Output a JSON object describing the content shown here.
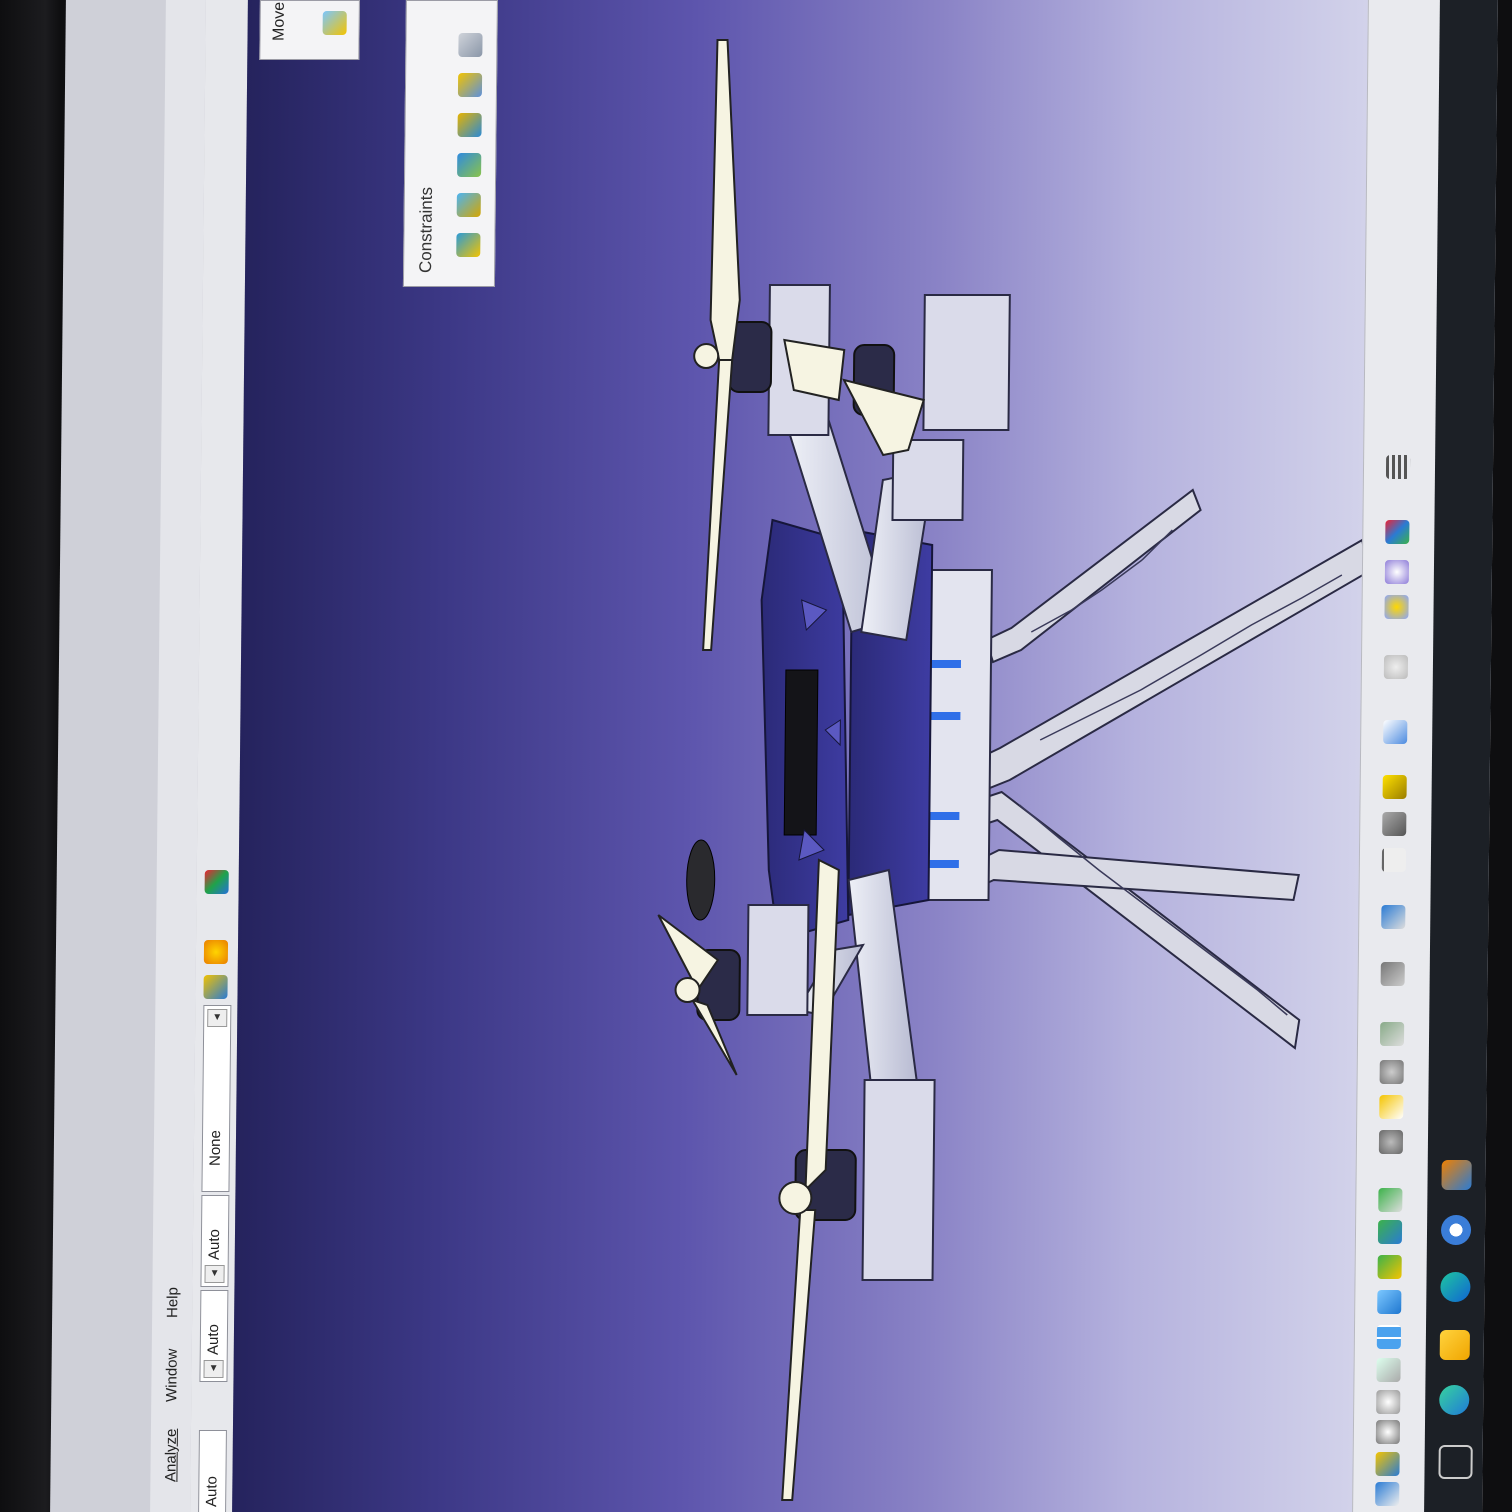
{
  "menu": {
    "items": [
      "Analyze",
      "Window",
      "Help"
    ]
  },
  "toolbar": {
    "combo_values": [
      "Auto",
      "Auto",
      "Auto",
      "None"
    ]
  },
  "panels": {
    "constraints_title": "Constraints",
    "move_title": "Move"
  },
  "viewport": {
    "background_gradient": [
      "#25235d",
      "#5d55ad",
      "#d2d2ea"
    ],
    "model": "quadcopter-assembly"
  },
  "icons": {
    "left_toolbar": [
      "paint-icon",
      "color-icon",
      "material-icon"
    ],
    "right_toolbar": [
      "grid-icon",
      "multi-color-icon",
      "sphere-icon",
      "star-icon",
      "refresh-icon",
      "cube-icon",
      "cylinder-icon",
      "stamp-icon",
      "measure-icon",
      "measure-item-icon",
      "camera-icon",
      "explode-icon",
      "gear-icon",
      "clash-icon",
      "gears-icon",
      "snap-icon",
      "view-icon",
      "normal-view-icon",
      "isometric-icon",
      "multi-view-icon",
      "plane-icon",
      "zoom-icon",
      "zoom-in-icon",
      "rotate-icon",
      "pan-icon"
    ],
    "taskbar": [
      "app-icon",
      "chrome-icon",
      "edge-icon",
      "files-icon",
      "edge-beta-icon",
      "task-view-icon"
    ]
  }
}
